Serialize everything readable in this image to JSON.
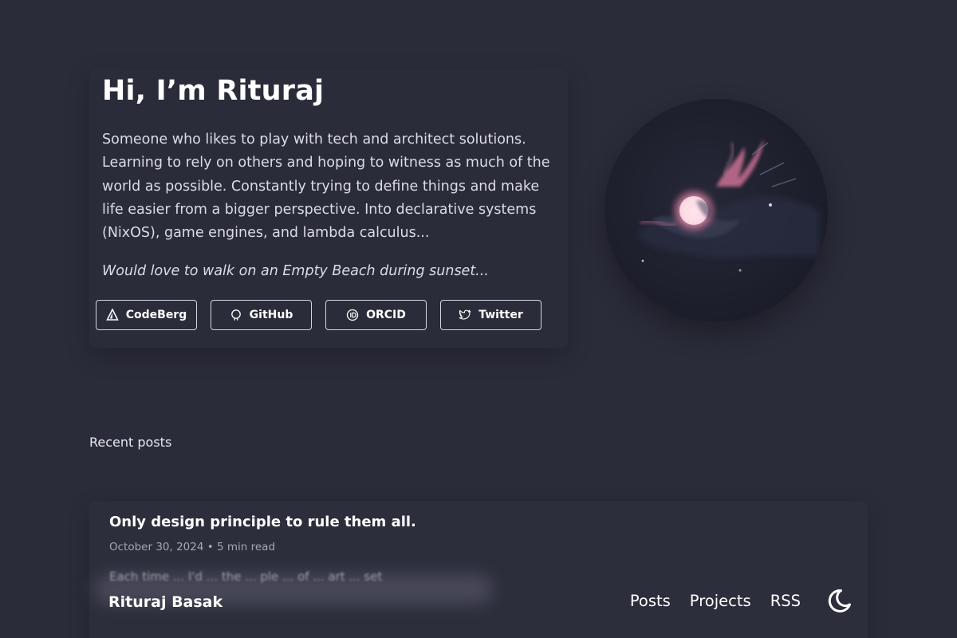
{
  "hero": {
    "title": "Hi, I’m Rituraj",
    "bio": "Someone who likes to play with tech and architect solutions. Learning to rely on others and hoping to witness as much of the world as possible. Constantly trying to define things and make life easier from a bigger perspective. Into declarative systems (NixOS), game engines, and lambda calculus...",
    "tagline": "Would love to walk on an Empty Beach during sunset...",
    "social": [
      {
        "label": "CodeBerg",
        "icon": "codeberg-icon"
      },
      {
        "label": "GitHub",
        "icon": "github-icon"
      },
      {
        "label": "ORCID",
        "icon": "orcid-icon"
      },
      {
        "label": "Twitter",
        "icon": "twitter-icon"
      }
    ]
  },
  "recent": {
    "label": "Recent posts",
    "posts": [
      {
        "title": "Only design principle to rule them all.",
        "meta": "October 30, 2024 • 5 min read",
        "excerpt": "Each time ... I'd ... the ... ple ... of ... art ... set"
      }
    ]
  },
  "footer": {
    "brand": "Rituraj Basak",
    "nav": [
      "Posts",
      "Projects",
      "RSS"
    ],
    "theme_icon": "moon-icon"
  },
  "colors": {
    "background": "#2b2c3a",
    "text": "#e6e6ee",
    "muted": "#a6a7b4",
    "accent_pink": "#f08fb0"
  }
}
